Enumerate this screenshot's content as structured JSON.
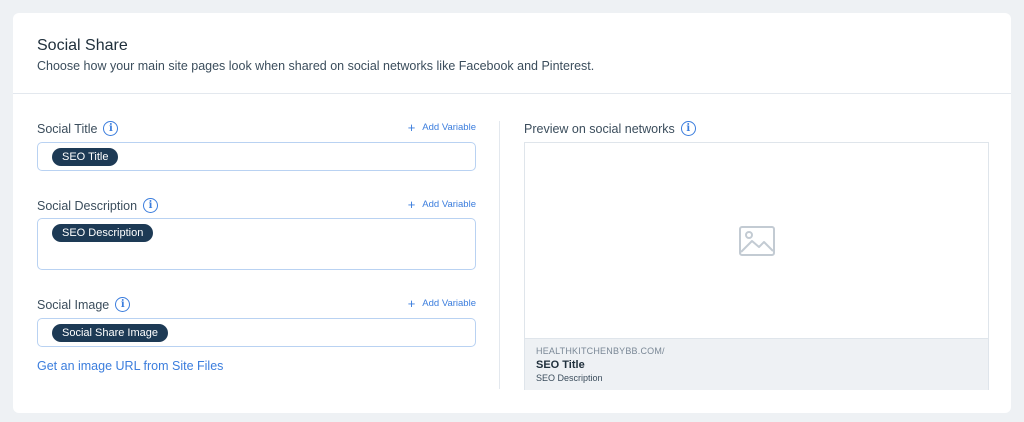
{
  "header": {
    "title": "Social Share",
    "subtitle": "Choose how your main site pages look when shared on social networks like Facebook and Pinterest."
  },
  "fields": {
    "social_title": {
      "label": "Social Title",
      "add_variable": "Add Variable",
      "chip": "SEO Title"
    },
    "social_description": {
      "label": "Social Description",
      "add_variable": "Add Variable",
      "chip": "SEO Description"
    },
    "social_image": {
      "label": "Social Image",
      "add_variable": "Add Variable",
      "chip": "Social Share Image"
    }
  },
  "image_link": "Get an image URL from Site Files",
  "preview": {
    "label": "Preview on social networks",
    "domain": "HEALTHKITCHENBYBB.COM/",
    "title": "SEO Title",
    "description": "SEO Description"
  },
  "icons": {
    "info": "info-icon",
    "plus": "plus-icon",
    "image_placeholder": "image-placeholder-icon"
  },
  "colors": {
    "accent": "#3b7ddd",
    "chip": "#1d3a55",
    "input_border": "#b9d2f2"
  }
}
